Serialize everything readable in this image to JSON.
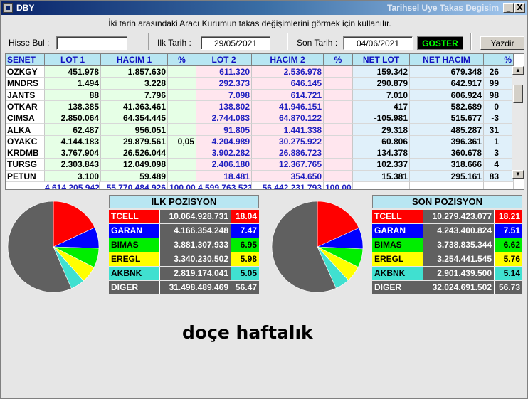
{
  "window": {
    "app_title": "DBY",
    "caption": "Tarihsel Uye Takas Degisim",
    "min_glyph": "_",
    "close_glyph": "X"
  },
  "hint": "İki tarih arasındaki  Aracı Kurumun takas değişimlerini görmek için kullanılır.",
  "filters": {
    "hisse_label": "Hisse Bul :",
    "hisse_value": "",
    "ilk_label": "Ilk Tarih :",
    "ilk_value": "29/05/2021",
    "son_label": "Son Tarih :",
    "son_value": "04/06/2021",
    "goster_label": "GOSTER",
    "yazdir_label": "Yazdir"
  },
  "grid": {
    "headers": [
      "SENET",
      "LOT 1",
      "HACIM 1",
      "%",
      "LOT 2",
      "HACIM 2",
      "%",
      "NET LOT",
      "NET HACIM",
      "%"
    ],
    "rows": [
      [
        "OZKGY",
        "451.978",
        "1.857.630",
        "",
        "611.320",
        "2.536.978",
        "",
        "159.342",
        "679.348",
        "26"
      ],
      [
        "MNDRS",
        "1.494",
        "3.228",
        "",
        "292.373",
        "646.145",
        "",
        "290.879",
        "642.917",
        "99"
      ],
      [
        "JANTS",
        "88",
        "7.796",
        "",
        "7.098",
        "614.721",
        "",
        "7.010",
        "606.924",
        "98"
      ],
      [
        "OTKAR",
        "138.385",
        "41.363.461",
        "",
        "138.802",
        "41.946.151",
        "",
        "417",
        "582.689",
        "0"
      ],
      [
        "CIMSA",
        "2.850.064",
        "64.354.445",
        "",
        "2.744.083",
        "64.870.122",
        "",
        "-105.981",
        "515.677",
        "-3"
      ],
      [
        "ALKA",
        "62.487",
        "956.051",
        "",
        "91.805",
        "1.441.338",
        "",
        "29.318",
        "485.287",
        "31"
      ],
      [
        "OYAKC",
        "4.144.183",
        "29.879.561",
        "0,05",
        "4.204.989",
        "30.275.922",
        "",
        "60.806",
        "396.361",
        "1"
      ],
      [
        "KRDMB",
        "3.767.904",
        "26.526.044",
        "",
        "3.902.282",
        "26.886.723",
        "",
        "134.378",
        "360.678",
        "3"
      ],
      [
        "TURSG",
        "2.303.843",
        "12.049.098",
        "",
        "2.406.180",
        "12.367.765",
        "",
        "102.337",
        "318.666",
        "4"
      ],
      [
        "PETUN",
        "3.100",
        "59.489",
        "",
        "18.481",
        "354.650",
        "",
        "15.381",
        "295.161",
        "83"
      ]
    ],
    "totals": [
      "",
      "4.614.205.942",
      "55.770.484.926",
      "100,00",
      "4.599.763.523",
      "56.442.231.793",
      "100,00",
      "",
      "",
      ""
    ]
  },
  "ilk_pozisyon": {
    "title": "ILK POZISYON",
    "rows": [
      {
        "name": "TCELL",
        "value": "10.064.928.731",
        "pct": "18.04",
        "pct_num": 18.04,
        "color": "#ff0000",
        "text_color": "#ffffff"
      },
      {
        "name": "GARAN",
        "value": "4.166.354.248",
        "pct": "7.47",
        "pct_num": 7.47,
        "color": "#0000ff",
        "text_color": "#ffffff"
      },
      {
        "name": "BIMAS",
        "value": "3.881.307.933",
        "pct": "6.95",
        "pct_num": 6.95,
        "color": "#00ee00",
        "text_color": "#000000"
      },
      {
        "name": "EREGL",
        "value": "3.340.230.502",
        "pct": "5.98",
        "pct_num": 5.98,
        "color": "#ffff00",
        "text_color": "#000000"
      },
      {
        "name": "AKBNK",
        "value": "2.819.174.041",
        "pct": "5.05",
        "pct_num": 5.05,
        "color": "#40e0d0",
        "text_color": "#000000"
      },
      {
        "name": "DIGER",
        "value": "31.498.489.469",
        "pct": "56.47",
        "pct_num": 56.47,
        "color": "#606060",
        "text_color": "#ffffff"
      }
    ]
  },
  "son_pozisyon": {
    "title": "SON POZISYON",
    "rows": [
      {
        "name": "TCELL",
        "value": "10.279.423.077",
        "pct": "18.21",
        "pct_num": 18.21,
        "color": "#ff0000",
        "text_color": "#ffffff"
      },
      {
        "name": "GARAN",
        "value": "4.243.400.824",
        "pct": "7.51",
        "pct_num": 7.51,
        "color": "#0000ff",
        "text_color": "#ffffff"
      },
      {
        "name": "BIMAS",
        "value": "3.738.835.344",
        "pct": "6.62",
        "pct_num": 6.62,
        "color": "#00ee00",
        "text_color": "#000000"
      },
      {
        "name": "EREGL",
        "value": "3.254.441.545",
        "pct": "5.76",
        "pct_num": 5.76,
        "color": "#ffff00",
        "text_color": "#000000"
      },
      {
        "name": "AKBNK",
        "value": "2.901.439.500",
        "pct": "5.14",
        "pct_num": 5.14,
        "color": "#40e0d0",
        "text_color": "#000000"
      },
      {
        "name": "DIGER",
        "value": "32.024.691.502",
        "pct": "56.73",
        "pct_num": 56.73,
        "color": "#606060",
        "text_color": "#ffffff"
      }
    ]
  },
  "overlay_text": "doçe haftalık",
  "icons": {
    "app": "window-app-icon",
    "scroll_up": "arrow-up-icon",
    "scroll_down": "arrow-down-icon"
  }
}
